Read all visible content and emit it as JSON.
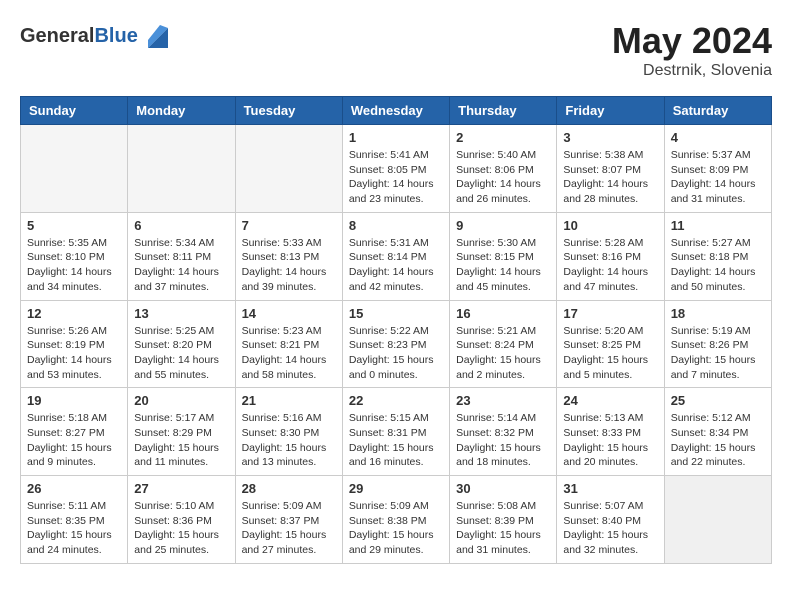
{
  "header": {
    "logo_general": "General",
    "logo_blue": "Blue",
    "month_year": "May 2024",
    "location": "Destrnik, Slovenia"
  },
  "weekdays": [
    "Sunday",
    "Monday",
    "Tuesday",
    "Wednesday",
    "Thursday",
    "Friday",
    "Saturday"
  ],
  "weeks": [
    [
      {
        "day": "",
        "empty": true
      },
      {
        "day": "",
        "empty": true
      },
      {
        "day": "",
        "empty": true
      },
      {
        "day": "1",
        "sunrise": "5:41 AM",
        "sunset": "8:05 PM",
        "daylight": "14 hours and 23 minutes."
      },
      {
        "day": "2",
        "sunrise": "5:40 AM",
        "sunset": "8:06 PM",
        "daylight": "14 hours and 26 minutes."
      },
      {
        "day": "3",
        "sunrise": "5:38 AM",
        "sunset": "8:07 PM",
        "daylight": "14 hours and 28 minutes."
      },
      {
        "day": "4",
        "sunrise": "5:37 AM",
        "sunset": "8:09 PM",
        "daylight": "14 hours and 31 minutes."
      }
    ],
    [
      {
        "day": "5",
        "sunrise": "5:35 AM",
        "sunset": "8:10 PM",
        "daylight": "14 hours and 34 minutes."
      },
      {
        "day": "6",
        "sunrise": "5:34 AM",
        "sunset": "8:11 PM",
        "daylight": "14 hours and 37 minutes."
      },
      {
        "day": "7",
        "sunrise": "5:33 AM",
        "sunset": "8:13 PM",
        "daylight": "14 hours and 39 minutes."
      },
      {
        "day": "8",
        "sunrise": "5:31 AM",
        "sunset": "8:14 PM",
        "daylight": "14 hours and 42 minutes."
      },
      {
        "day": "9",
        "sunrise": "5:30 AM",
        "sunset": "8:15 PM",
        "daylight": "14 hours and 45 minutes."
      },
      {
        "day": "10",
        "sunrise": "5:28 AM",
        "sunset": "8:16 PM",
        "daylight": "14 hours and 47 minutes."
      },
      {
        "day": "11",
        "sunrise": "5:27 AM",
        "sunset": "8:18 PM",
        "daylight": "14 hours and 50 minutes."
      }
    ],
    [
      {
        "day": "12",
        "sunrise": "5:26 AM",
        "sunset": "8:19 PM",
        "daylight": "14 hours and 53 minutes."
      },
      {
        "day": "13",
        "sunrise": "5:25 AM",
        "sunset": "8:20 PM",
        "daylight": "14 hours and 55 minutes."
      },
      {
        "day": "14",
        "sunrise": "5:23 AM",
        "sunset": "8:21 PM",
        "daylight": "14 hours and 58 minutes."
      },
      {
        "day": "15",
        "sunrise": "5:22 AM",
        "sunset": "8:23 PM",
        "daylight": "15 hours and 0 minutes."
      },
      {
        "day": "16",
        "sunrise": "5:21 AM",
        "sunset": "8:24 PM",
        "daylight": "15 hours and 2 minutes."
      },
      {
        "day": "17",
        "sunrise": "5:20 AM",
        "sunset": "8:25 PM",
        "daylight": "15 hours and 5 minutes."
      },
      {
        "day": "18",
        "sunrise": "5:19 AM",
        "sunset": "8:26 PM",
        "daylight": "15 hours and 7 minutes."
      }
    ],
    [
      {
        "day": "19",
        "sunrise": "5:18 AM",
        "sunset": "8:27 PM",
        "daylight": "15 hours and 9 minutes."
      },
      {
        "day": "20",
        "sunrise": "5:17 AM",
        "sunset": "8:29 PM",
        "daylight": "15 hours and 11 minutes."
      },
      {
        "day": "21",
        "sunrise": "5:16 AM",
        "sunset": "8:30 PM",
        "daylight": "15 hours and 13 minutes."
      },
      {
        "day": "22",
        "sunrise": "5:15 AM",
        "sunset": "8:31 PM",
        "daylight": "15 hours and 16 minutes."
      },
      {
        "day": "23",
        "sunrise": "5:14 AM",
        "sunset": "8:32 PM",
        "daylight": "15 hours and 18 minutes."
      },
      {
        "day": "24",
        "sunrise": "5:13 AM",
        "sunset": "8:33 PM",
        "daylight": "15 hours and 20 minutes."
      },
      {
        "day": "25",
        "sunrise": "5:12 AM",
        "sunset": "8:34 PM",
        "daylight": "15 hours and 22 minutes."
      }
    ],
    [
      {
        "day": "26",
        "sunrise": "5:11 AM",
        "sunset": "8:35 PM",
        "daylight": "15 hours and 24 minutes."
      },
      {
        "day": "27",
        "sunrise": "5:10 AM",
        "sunset": "8:36 PM",
        "daylight": "15 hours and 25 minutes."
      },
      {
        "day": "28",
        "sunrise": "5:09 AM",
        "sunset": "8:37 PM",
        "daylight": "15 hours and 27 minutes."
      },
      {
        "day": "29",
        "sunrise": "5:09 AM",
        "sunset": "8:38 PM",
        "daylight": "15 hours and 29 minutes."
      },
      {
        "day": "30",
        "sunrise": "5:08 AM",
        "sunset": "8:39 PM",
        "daylight": "15 hours and 31 minutes."
      },
      {
        "day": "31",
        "sunrise": "5:07 AM",
        "sunset": "8:40 PM",
        "daylight": "15 hours and 32 minutes."
      },
      {
        "day": "",
        "empty": true,
        "shaded": true
      }
    ]
  ]
}
